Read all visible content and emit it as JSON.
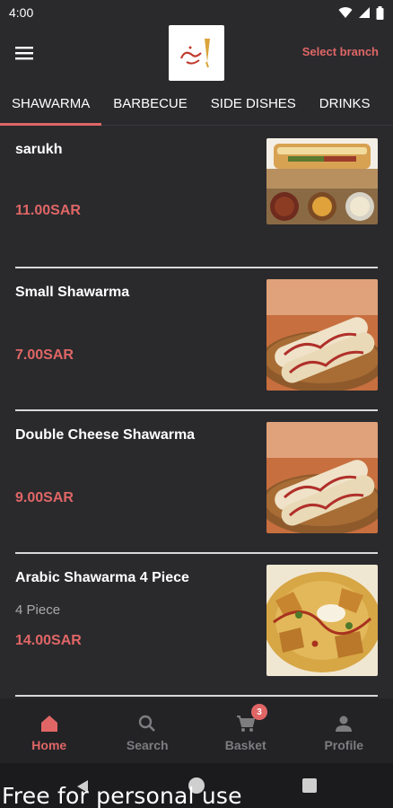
{
  "status_bar": {
    "time": "4:00"
  },
  "header": {
    "select_branch": "Select branch"
  },
  "tabs": [
    {
      "label": "SHAWARMA",
      "active": true
    },
    {
      "label": "BARBECUE"
    },
    {
      "label": "SIDE DISHES"
    },
    {
      "label": "DRINKS"
    }
  ],
  "items": [
    {
      "name": "sarukh",
      "description": "",
      "price": "11.00SAR",
      "image": "sandwich-platter-image"
    },
    {
      "name": "Small Shawarma",
      "description": "",
      "price": "7.00SAR",
      "image": "shawarma-wrap-image"
    },
    {
      "name": "Double Cheese Shawarma",
      "description": "",
      "price": "9.00SAR",
      "image": "shawarma-wrap-image"
    },
    {
      "name": "Arabic Shawarma 4 Piece",
      "description": "4 Piece",
      "price": "14.00SAR",
      "image": "arabic-shawarma-platter-image"
    }
  ],
  "bottom_nav": {
    "home": "Home",
    "search": "Search",
    "basket": "Basket",
    "basket_count": "3",
    "profile": "Profile"
  },
  "watermark": "Free for personal use",
  "colors": {
    "accent": "#e06666",
    "background": "#2a2a2d"
  }
}
